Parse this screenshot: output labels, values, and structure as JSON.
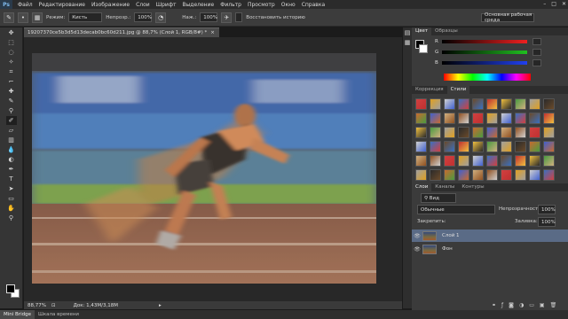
{
  "app": {
    "logo": "Ps"
  },
  "menu": [
    "Файл",
    "Редактирование",
    "Изображение",
    "Слои",
    "Шрифт",
    "Выделение",
    "Фильтр",
    "Просмотр",
    "Окно",
    "Справка"
  ],
  "options": {
    "mode_label": "Режим:",
    "mode_value": "Кисть",
    "opacity_label": "Непрозр.:",
    "opacity_value": "100%",
    "pressure_label": "Наж.:",
    "pressure_value": "100%",
    "history_label": "Восстановить историю",
    "workspace": "Основная рабочая среда"
  },
  "document": {
    "tab_title": "19207370ce5b3d5d13decab0bc60d211.jpg @ 88,7% (Слой 1, RGB/8#) *",
    "close": "×"
  },
  "status": {
    "zoom": "88,77%",
    "doc": "Док: 1,43M/3,18M"
  },
  "bottom_tabs": [
    "Mini Bridge",
    "Шкала времени"
  ],
  "panels": {
    "color_tabs": [
      "Цвет",
      "Образцы"
    ],
    "color_sliders": [
      {
        "label": "R",
        "color": "#e03030"
      },
      {
        "label": "G",
        "color": "#30c030"
      },
      {
        "label": "B",
        "color": "#3050e0"
      }
    ],
    "style_tabs": [
      "Коррекция",
      "Стили"
    ],
    "layers_tabs": [
      "Слои",
      "Каналы",
      "Контуры"
    ],
    "kind_label": "Вид",
    "blend_mode": "Обычные",
    "opacity_label": "Непрозрачность:",
    "opacity_value": "100%",
    "lock_label": "Закрепить:",
    "fill_label": "Заливка:",
    "fill_value": "100%",
    "layers": [
      {
        "name": "Слой 1",
        "selected": true
      },
      {
        "name": "Фон",
        "selected": false
      }
    ]
  }
}
